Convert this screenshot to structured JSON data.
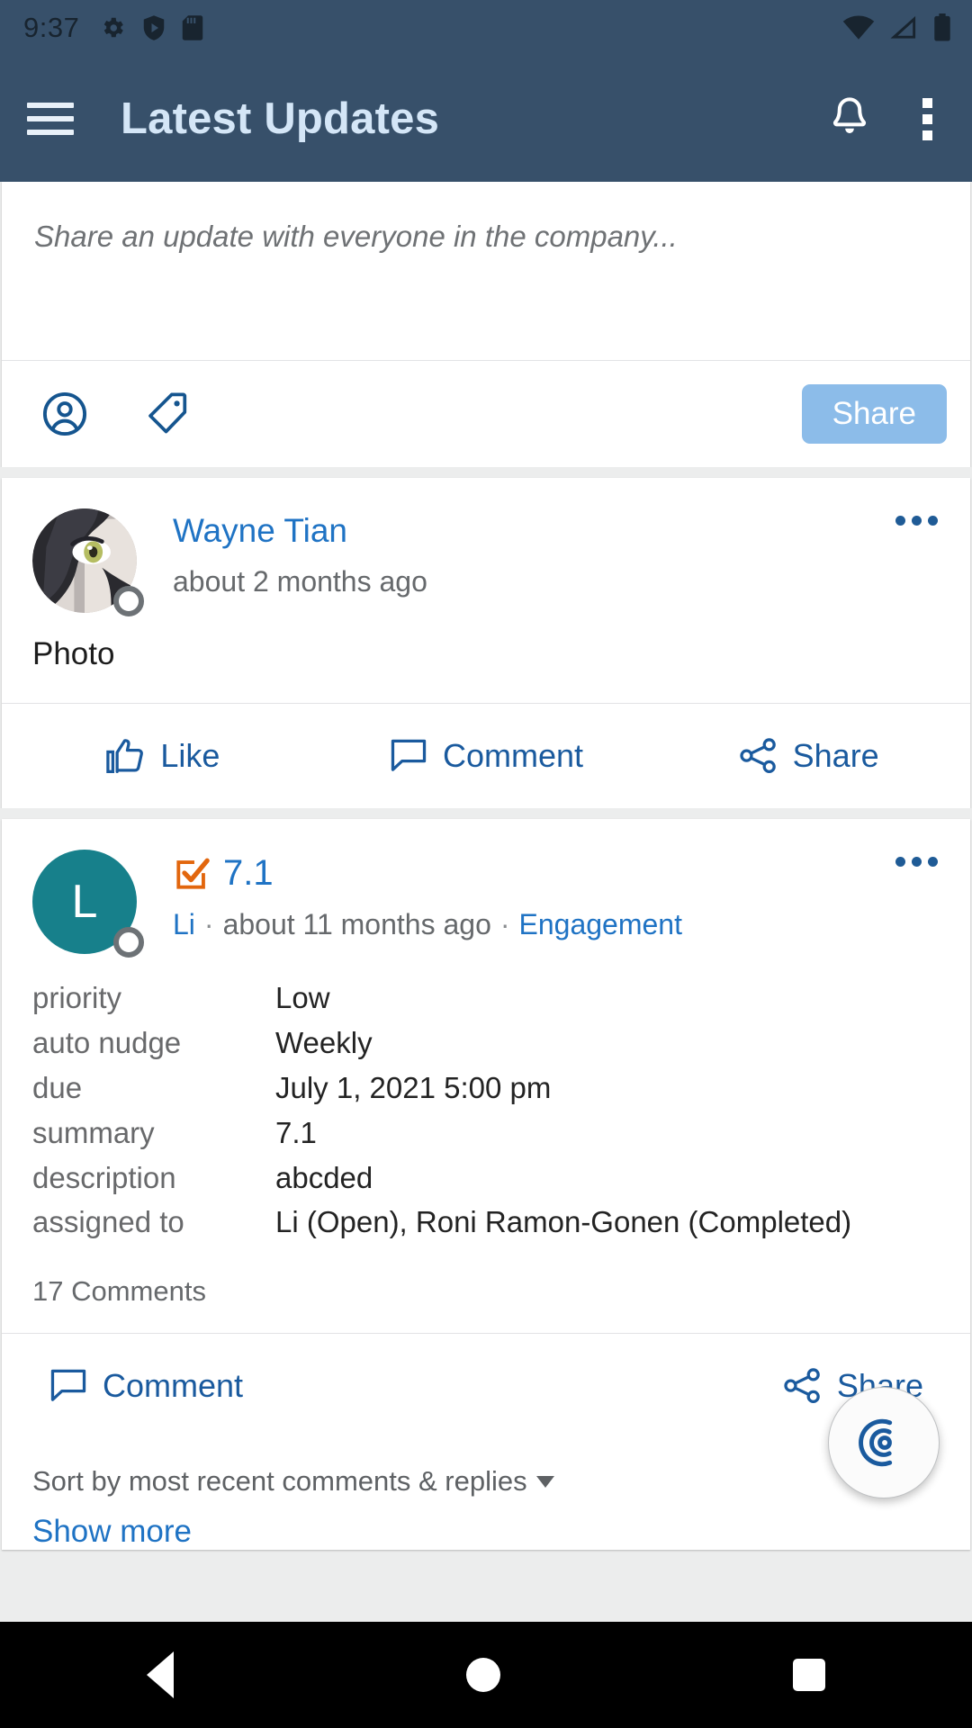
{
  "status_bar": {
    "time": "9:37",
    "left_icons": [
      "gear-icon",
      "play-shield-icon",
      "sd-card-icon"
    ],
    "right_icons": [
      "wifi-icon",
      "cellular-signal-icon",
      "battery-icon"
    ]
  },
  "toolbar": {
    "menu_icon": "hamburger-menu-icon",
    "title": "Latest Updates",
    "notification_icon": "bell-icon",
    "overflow_icon": "kebab-menu-icon",
    "background_color": "#37506a",
    "title_color": "#d4e6f7"
  },
  "composer": {
    "placeholder": "Share an update with everyone in the company...",
    "icons": [
      "person-circle-icon",
      "tag-icon"
    ],
    "share_label": "Share",
    "share_button_color": "#8cbce9"
  },
  "posts": [
    {
      "type": "photo_update",
      "avatar_kind": "image",
      "avatar_letter": "",
      "author": "Wayne Tian",
      "timestamp": "about 2 months ago",
      "body": "Photo",
      "overflow_icon": "more-horizontal-icon",
      "actions": [
        {
          "label": "Like",
          "icon": "thumbs-up-icon"
        },
        {
          "label": "Comment",
          "icon": "comment-bubble-icon"
        },
        {
          "label": "Share",
          "icon": "share-nodes-icon"
        }
      ]
    },
    {
      "type": "task_update",
      "avatar_kind": "letter",
      "avatar_letter": "L",
      "avatar_color": "#17808b",
      "task_icon": "checkbox-checked-icon",
      "task_icon_color": "#e2660d",
      "title": "7.1",
      "author": "Li",
      "timestamp": "about 11 months ago",
      "category": "Engagement",
      "overflow_icon": "more-horizontal-icon",
      "fields": [
        {
          "label": "priority",
          "value": "Low"
        },
        {
          "label": "auto nudge",
          "value": "Weekly"
        },
        {
          "label": "due",
          "value": "July 1, 2021 5:00 pm"
        },
        {
          "label": "summary",
          "value": "7.1"
        },
        {
          "label": "description",
          "value": "abcded"
        },
        {
          "label": "assigned to",
          "value": "Li (Open), Roni Ramon-Gonen (Completed)"
        }
      ],
      "comments_count": "17 Comments",
      "actions": [
        {
          "label": "Comment",
          "icon": "comment-bubble-icon"
        },
        {
          "label": "Share",
          "icon": "share-nodes-icon"
        }
      ],
      "sort_label": "Sort by most recent comments & replies",
      "show_more_label": "Show more"
    }
  ],
  "fab": {
    "icon": "spiral-target-icon"
  },
  "nav_bar": {
    "back_icon": "triangle-back-icon",
    "home_icon": "circle-home-icon",
    "recents_icon": "square-recents-icon"
  },
  "colors": {
    "link_blue": "#1f73c4",
    "action_blue": "#1a5a9e",
    "page_background": "#eceded"
  }
}
